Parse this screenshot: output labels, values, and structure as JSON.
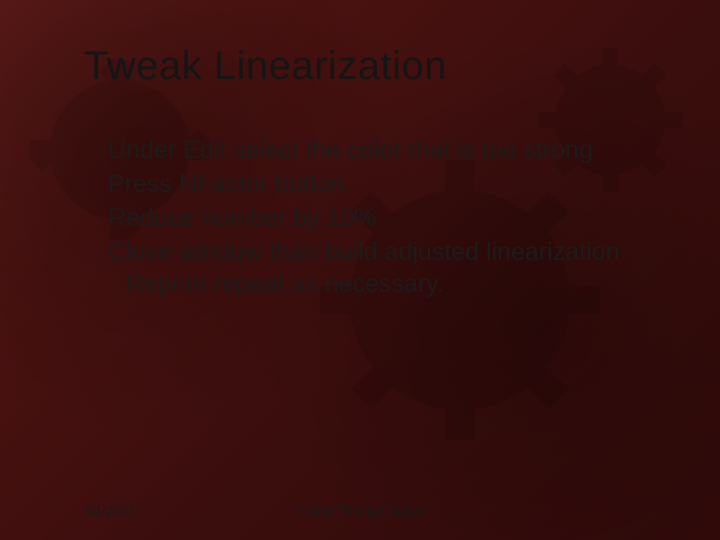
{
  "title": "Tweak Linearization",
  "bullets": [
    "Under Edit select the color that is too strong",
    "Press NFactor button.",
    "Reduce number by 10%",
    "Close window  than build adjusted linearization Reprint repeat as necessary."
  ],
  "footer": {
    "date": "5/1/2003",
    "author": "KWitte Triangle Digital"
  }
}
